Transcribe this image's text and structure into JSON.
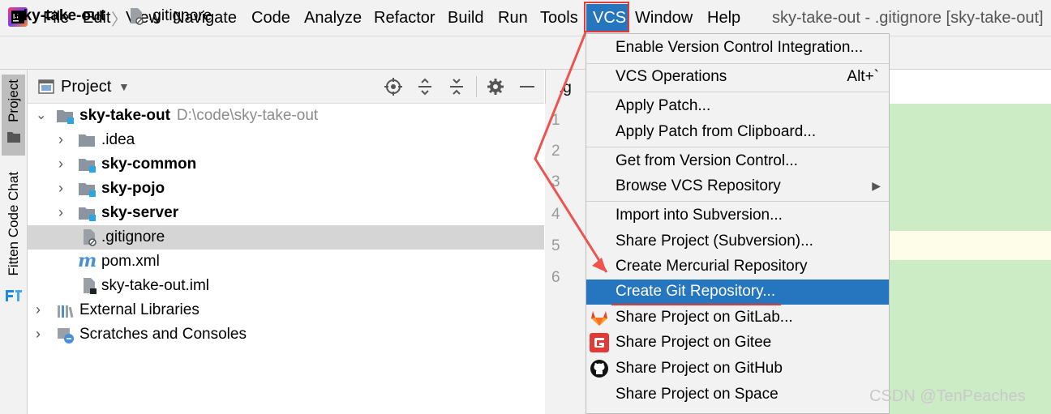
{
  "menubar": {
    "items": [
      "File",
      "Edit",
      "View",
      "Navigate",
      "Code",
      "Analyze",
      "Refactor",
      "Build",
      "Run",
      "Tools",
      "VCS",
      "Window",
      "Help"
    ],
    "window_title": "sky-take-out - .gitignore [sky-take-out]"
  },
  "breadcrumb": {
    "root": "sky-take-out",
    "file": ".gitignore"
  },
  "toolstrip": {
    "project_tab": "Project",
    "plugin_tab": "Fitten Code Chat"
  },
  "project_panel": {
    "title": "Project",
    "tree": [
      {
        "label": "sky-take-out",
        "path": "D:\\code\\sky-take-out"
      },
      {
        "label": ".idea"
      },
      {
        "label": "sky-common"
      },
      {
        "label": "sky-pojo"
      },
      {
        "label": "sky-server"
      },
      {
        "label": ".gitignore"
      },
      {
        "label": "pom.xml"
      },
      {
        "label": "sky-take-out.iml"
      },
      {
        "label": "External Libraries"
      },
      {
        "label": "Scratches and Consoles"
      }
    ]
  },
  "editor": {
    "tab_label": ".g",
    "line_numbers": [
      "1",
      "2",
      "3",
      "4",
      "5",
      "6"
    ]
  },
  "vcs_menu": {
    "items": [
      {
        "label": "Enable Version Control Integration..."
      },
      {
        "label": "VCS Operations",
        "shortcut": "Alt+`"
      },
      {
        "label": "Apply Patch..."
      },
      {
        "label": "Apply Patch from Clipboard..."
      },
      {
        "label": "Get from Version Control..."
      },
      {
        "label": "Browse VCS Repository"
      },
      {
        "label": "Import into Subversion..."
      },
      {
        "label": "Share Project (Subversion)..."
      },
      {
        "label": "Create Mercurial Repository"
      },
      {
        "label": "Create Git Repository..."
      },
      {
        "label": "Share Project on GitLab..."
      },
      {
        "label": "Share Project on Gitee"
      },
      {
        "label": "Share Project on GitHub"
      },
      {
        "label": "Share Project on Space"
      }
    ],
    "highlighted": "Create Git Repository..."
  },
  "watermark": "CSDN @TenPeaches",
  "colors": {
    "accent": "#2675bf",
    "annotation": "#e53935",
    "editor_bg": "#ccecc6"
  }
}
